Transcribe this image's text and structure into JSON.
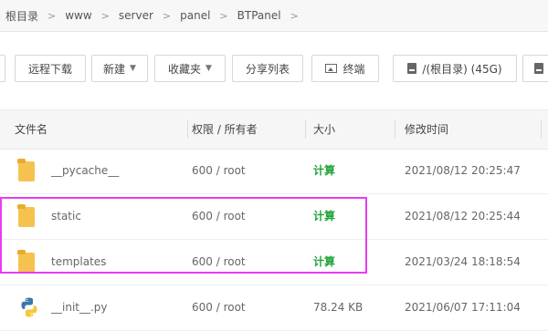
{
  "breadcrumb": [
    "根目录",
    "www",
    "server",
    "panel",
    "BTPanel"
  ],
  "toolbar": {
    "remote_download": "远程下载",
    "new": "新建",
    "favorites": "收藏夹",
    "share_list": "分享列表",
    "terminal": "终端",
    "disk": "/(根目录) (45G)"
  },
  "table": {
    "headers": {
      "name": "文件名",
      "perm": "权限 / 所有者",
      "size": "大小",
      "mtime": "修改时间"
    },
    "rows": [
      {
        "name": "__pycache__",
        "perm": "600 / root",
        "size": "计算",
        "mtime": "2021/08/12 20:25:47",
        "icon": "folder-icon"
      },
      {
        "name": "static",
        "perm": "600 / root",
        "size": "计算",
        "mtime": "2021/08/12 20:25:44",
        "icon": "folder-icon"
      },
      {
        "name": "templates",
        "perm": "600 / root",
        "size": "计算",
        "mtime": "2021/03/24 18:18:54",
        "icon": "folder-icon"
      },
      {
        "name": "__init__.py",
        "perm": "600 / root",
        "size": "78.24 KB",
        "mtime": "2021/06/07 17:11:04",
        "icon": "python-file-icon"
      }
    ]
  },
  "colors": {
    "highlight": "#e83cf2",
    "calc_green": "#20a53a",
    "folder": "#f6c24f"
  }
}
